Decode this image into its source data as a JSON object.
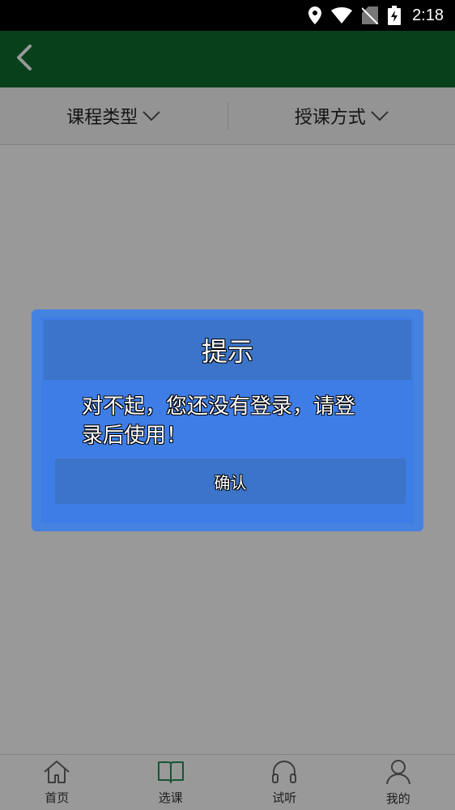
{
  "status_bar": {
    "time": "2:18",
    "icons": [
      "location-icon",
      "wifi-icon",
      "no-sim-icon",
      "battery-charging-icon"
    ]
  },
  "app_bar": {
    "back_icon": "chevron-left-icon",
    "color": "#0e6b2f"
  },
  "filters": [
    {
      "label": "课程类型",
      "icon": "chevron-down-icon"
    },
    {
      "label": "授课方式",
      "icon": "chevron-down-icon"
    }
  ],
  "bottom_nav": [
    {
      "label": "首页",
      "icon": "home-icon",
      "active": false
    },
    {
      "label": "选课",
      "icon": "book-icon",
      "active": true
    },
    {
      "label": "试听",
      "icon": "headphones-icon",
      "active": false
    },
    {
      "label": "我的",
      "icon": "user-icon",
      "active": false
    }
  ],
  "dialog": {
    "title": "提示",
    "message": "对不起，您还没有登录，请登录后使用！",
    "confirm_label": "确认",
    "accent": "#3f7de6"
  },
  "colors": {
    "primary": "#0e6b2f",
    "nav_active": "#2e8b57"
  }
}
